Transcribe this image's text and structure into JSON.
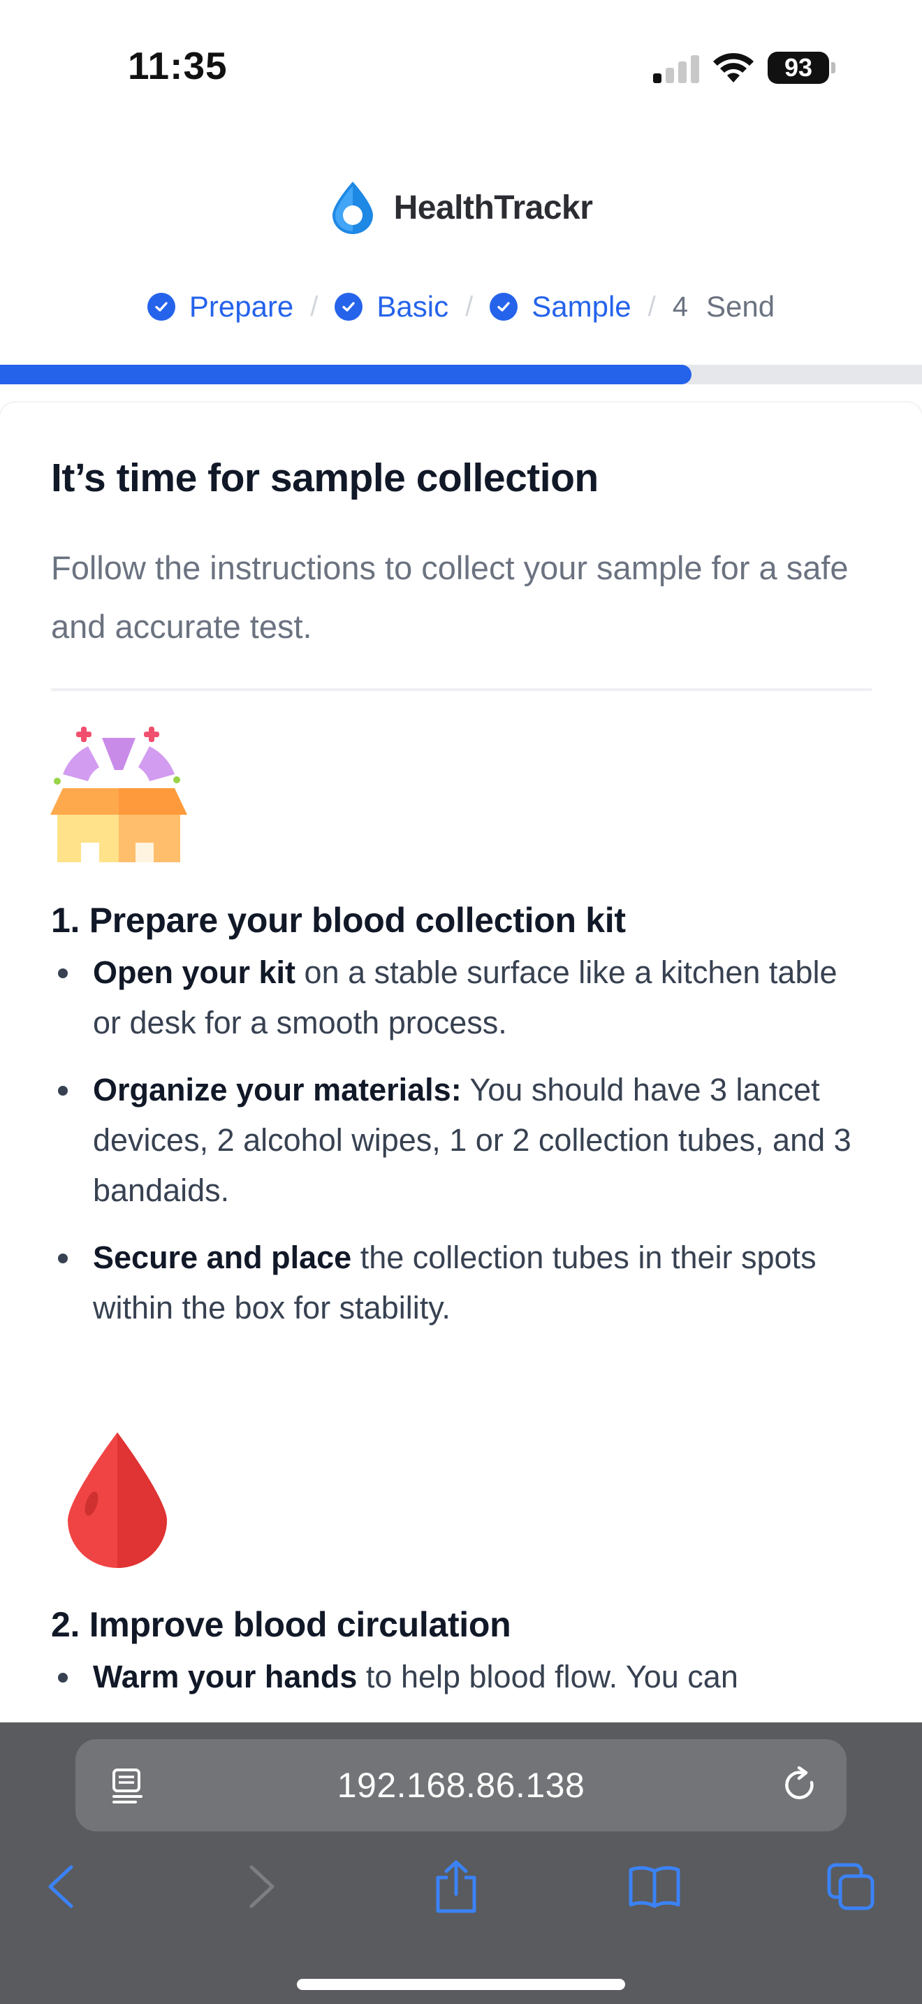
{
  "status_bar": {
    "time": "11:35",
    "battery": "93",
    "icons": [
      "signal-icon",
      "wifi-icon",
      "battery-icon"
    ]
  },
  "brand": {
    "name": "HealthTrackr",
    "logo_color": "#1e88e5"
  },
  "stepper": {
    "steps": [
      {
        "label": "Prepare",
        "state": "done"
      },
      {
        "label": "Basic",
        "state": "done"
      },
      {
        "label": "Sample",
        "state": "done"
      },
      {
        "number": "4",
        "label": "Send",
        "state": "pending"
      }
    ],
    "separator": "/"
  },
  "progress": {
    "percent": 75
  },
  "content": {
    "title": "It’s time for sample collection",
    "subtitle": "Follow the instructions to collect your sample for a safe and accurate test.",
    "sections": [
      {
        "icon": "open-box-icon",
        "title": "1. Prepare your blood collection kit",
        "bullets": [
          {
            "bold": "Open your kit",
            "text": " on a stable surface like a kitchen table or desk for a smooth process."
          },
          {
            "bold": "Organize your materials:",
            "text": " You should have 3 lancet devices, 2 alcohol wipes, 1 or 2 collection tubes, and 3 bandaids."
          },
          {
            "bold": "Secure and place",
            "text": " the collection tubes in their spots within the box for stability."
          }
        ]
      },
      {
        "icon": "blood-drop-icon",
        "title": "2. Improve blood circulation",
        "bullets": [
          {
            "bold": "Warm your hands",
            "text": " to help blood flow. You can"
          }
        ]
      }
    ]
  },
  "browser": {
    "url": "192.168.86.138",
    "toolbar": [
      "back-icon",
      "forward-icon",
      "share-icon",
      "bookmarks-icon",
      "tabs-icon"
    ]
  },
  "colors": {
    "accent": "#2563eb",
    "drop": "#f04444",
    "browser_bg": "#5a5b5e"
  }
}
